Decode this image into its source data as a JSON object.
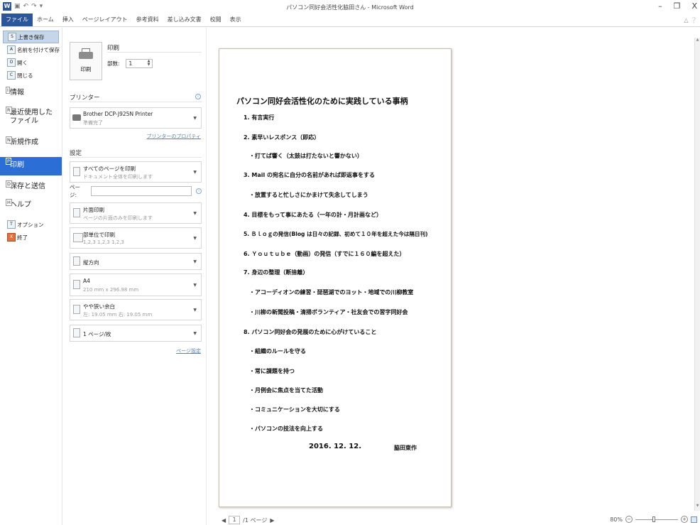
{
  "window": {
    "title": "パソコン同好会活性化脇田さん - Microsoft Word",
    "word_icon": "W",
    "qat_items": [
      "save-icon",
      "undo-icon",
      "redo-icon",
      "customize-icon"
    ],
    "controls": [
      "–",
      "❐",
      "X"
    ]
  },
  "ribbon": {
    "tabs": [
      "ファイル",
      "ホーム",
      "挿入",
      "ページレイアウト",
      "参考資料",
      "差し込み文書",
      "校閲",
      "表示"
    ],
    "active_tab": "ファイル"
  },
  "nav": {
    "small_items": [
      {
        "key": "S",
        "label": "上書き保存"
      },
      {
        "key": "A",
        "label": "名前を付けて保存"
      },
      {
        "key": "O",
        "label": "開く"
      },
      {
        "key": "C",
        "label": "閉じる"
      }
    ],
    "info": {
      "key": "I",
      "label": "情報"
    },
    "recent": {
      "key": "R",
      "label_1": "最近使用した",
      "label_2": "ファイル"
    },
    "new": {
      "key": "N",
      "label": "新規作成"
    },
    "print": {
      "key": "P",
      "label": "印刷"
    },
    "save_send": {
      "key": "D",
      "label": "保存と送信"
    },
    "help": {
      "key": "H",
      "label": "ヘルプ"
    },
    "options": {
      "key": "T",
      "label": "オプション"
    },
    "exit": {
      "key": "X",
      "label": "終了"
    }
  },
  "print": {
    "title": "印刷",
    "button_label": "印刷",
    "copies_label": "部数:",
    "copies_value": "1",
    "printer_header": "プリンター",
    "printer_name": "Brother DCP-J925N Printer",
    "printer_status": "準備完了",
    "printer_props_link": "プリンターのプロパティ",
    "settings_header": "設定",
    "pages_label": "ページ:",
    "pages_value": "",
    "page_setup_link": "ページ設定",
    "options": [
      {
        "l1": "すべてのページを印刷",
        "l2": "ドキュメント全体を印刷します"
      },
      {
        "l1": "片面印刷",
        "l2": "ページの片面のみを印刷します"
      },
      {
        "l1": "部単位で印刷",
        "l2": "1,2,3   1,2,3   1,2,3"
      },
      {
        "l1": "縦方向",
        "l2": ""
      },
      {
        "l1": "A4",
        "l2": "210 mm x 296.98 mm"
      },
      {
        "l1": "やや狭い余白",
        "l2": "左: 19.05 mm   右: 19.05 mm"
      },
      {
        "l1": "1 ページ/枚",
        "l2": ""
      }
    ]
  },
  "document": {
    "title": "パソコン同好会活性化のために実践している事柄",
    "lines": [
      "1.  有言実行",
      "2.  素早いレスポンス（即応）",
      "・打てば響く（太鼓は打たないと響かない）",
      "3.  Mail の宛名に自分の名前があれば即返事をする",
      "・放置すると忙しさにかまけて失念してしまう",
      "4.  目標をもって事にあたる（一年の計・月計画など）",
      "5.  Ｂｌｏｇの発信(Blog は日々の記録、初めて１０年を超えた今は隔日刊)",
      "6.  Ｙｏｕｔｕｂｅ（動画）の発信（すでに１６０編を超えた）",
      "7.  身辺の整理（断捨離）",
      "・アコーディオンの練習・琵琶湖でのヨット・地域での川柳教室",
      "・川柳の新聞投稿・清掃ボランティア・社友会での習字同好会",
      "8.  パソコン同好会の発展のために心がけていること",
      "・組織のルールを守る",
      "・常に課題を持つ",
      "・月例会に焦点を当てた活動",
      "・コミュニケーションを大切にする",
      "・パソコンの技法を向上する"
    ],
    "date": "2016. 12. 12.",
    "author": "脇田東作"
  },
  "status": {
    "page_current": "1",
    "page_total": "/1 ページ",
    "zoom": "80%"
  }
}
